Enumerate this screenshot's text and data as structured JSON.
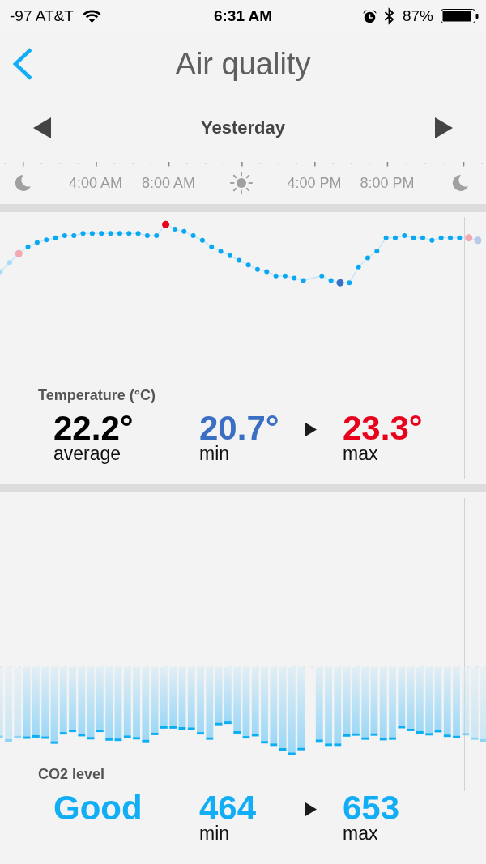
{
  "status_bar": {
    "network": "-97 AT&T",
    "time": "6:31 AM",
    "battery": "87%"
  },
  "nav": {
    "title": "Air quality"
  },
  "date_nav": {
    "label": "Yesterday"
  },
  "timeline": {
    "marks": [
      {
        "kind": "moon"
      },
      {
        "kind": "time",
        "label": "4:00 AM"
      },
      {
        "kind": "time",
        "label": "8:00 AM"
      },
      {
        "kind": "sun"
      },
      {
        "kind": "time",
        "label": "4:00 PM"
      },
      {
        "kind": "time",
        "label": "8:00 PM"
      },
      {
        "kind": "moon"
      }
    ]
  },
  "panels": [
    {
      "kind": "line",
      "title": "Temperature (°C)",
      "summary": {
        "value": "22.2°",
        "label": "average",
        "color": "#000000"
      },
      "min": {
        "value": "20.7°",
        "label": "min",
        "color": "#3a6fc4"
      },
      "max": {
        "value": "23.3°",
        "label": "max",
        "color": "#e8001c"
      }
    },
    {
      "kind": "bar",
      "title": "CO2 level",
      "summary": {
        "value": "Good",
        "color": "#12aef5"
      },
      "min": {
        "value": "464",
        "label": "min",
        "color": "#12aef5"
      },
      "max": {
        "value": "653",
        "label": "max",
        "color": "#12aef5"
      }
    }
  ]
}
